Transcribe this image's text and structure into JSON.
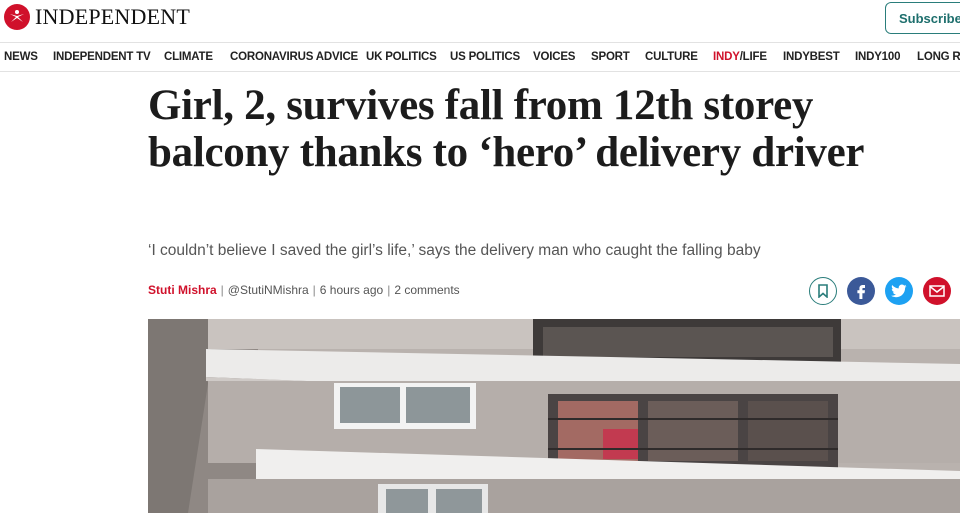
{
  "header": {
    "logo_text": "INDEPENDENT",
    "subscribe_label": "Subscribe",
    "brand_color": "#d0112b",
    "accent_color": "#2a7d7b"
  },
  "nav": {
    "items": [
      "NEWS",
      "INDEPENDENT TV",
      "CLIMATE",
      "CORONAVIRUS ADVICE",
      "UK POLITICS",
      "US POLITICS",
      "VOICES",
      "SPORT",
      "CULTURE",
      "INDY/LIFE",
      "INDYBEST",
      "INDY100",
      "LONG RE"
    ],
    "indy_part1": "INDY",
    "indy_part2": "/LIFE"
  },
  "article": {
    "headline": "Girl, 2, survives fall from 12th storey balcony thanks to ‘hero’ delivery driver",
    "standfirst": "‘I couldn’t believe I saved the girl’s life,’ says the delivery man who caught the falling baby",
    "author": "Stuti Mishra",
    "handle": "@StutiNMishra",
    "time": "6 hours ago",
    "comments": "2 comments",
    "sep": "|"
  },
  "share_icons": [
    "bookmark-icon",
    "facebook-icon",
    "twitter-icon",
    "email-icon"
  ]
}
